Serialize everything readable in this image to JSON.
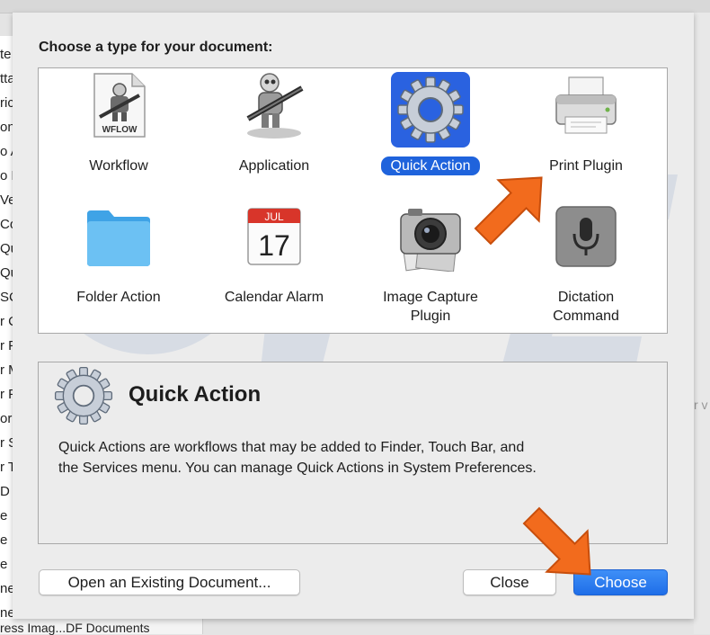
{
  "dialog": {
    "prompt": "Choose a type for your document:",
    "types": [
      {
        "label": "Workflow",
        "icon": "workflow-doc-icon",
        "icon_text": "WFLOW",
        "selected": false
      },
      {
        "label": "Application",
        "icon": "automator-robot-icon",
        "selected": false
      },
      {
        "label": "Quick Action",
        "icon": "gear-icon",
        "selected": true
      },
      {
        "label": "Print Plugin",
        "icon": "printer-icon",
        "selected": false
      },
      {
        "label": "Folder Action",
        "icon": "folder-icon",
        "selected": false
      },
      {
        "label": "Calendar Alarm",
        "icon": "calendar-icon",
        "icon_month": "JUL",
        "icon_day": "17",
        "selected": false
      },
      {
        "label": "Image Capture Plugin",
        "label_lines": [
          "Image Capture",
          "Plugin"
        ],
        "icon": "camera-icon",
        "selected": false
      },
      {
        "label": "Dictation Command",
        "label_lines": [
          "Dictation",
          "Command"
        ],
        "icon": "microphone-icon",
        "selected": false
      }
    ],
    "detail": {
      "title": "Quick Action",
      "description_lines": [
        "Quick Actions are workflows that may be added to Finder, Touch Bar, and",
        "the Services menu. You can manage Quick Actions in System Preferences."
      ]
    },
    "buttons": {
      "open_existing": "Open an Existing Document...",
      "close": "Close",
      "choose": "Choose"
    }
  },
  "background": {
    "sidebar_fragments": [
      "te",
      "tta",
      "ric",
      "on",
      "o A",
      "o F",
      "Ve",
      "Co",
      "Qu",
      "Qu",
      "SC",
      "r C",
      "r F",
      "r M",
      "r F",
      "or",
      "r S",
      "r T",
      "D",
      "e",
      "e",
      "e",
      "ne",
      "ne"
    ],
    "bottom_text": "ress Imag...DF Documents",
    "right_text": "r v"
  },
  "colors": {
    "accent": "#1f63dc",
    "arrow": "#f26b1d",
    "sheet": "#ececec"
  }
}
